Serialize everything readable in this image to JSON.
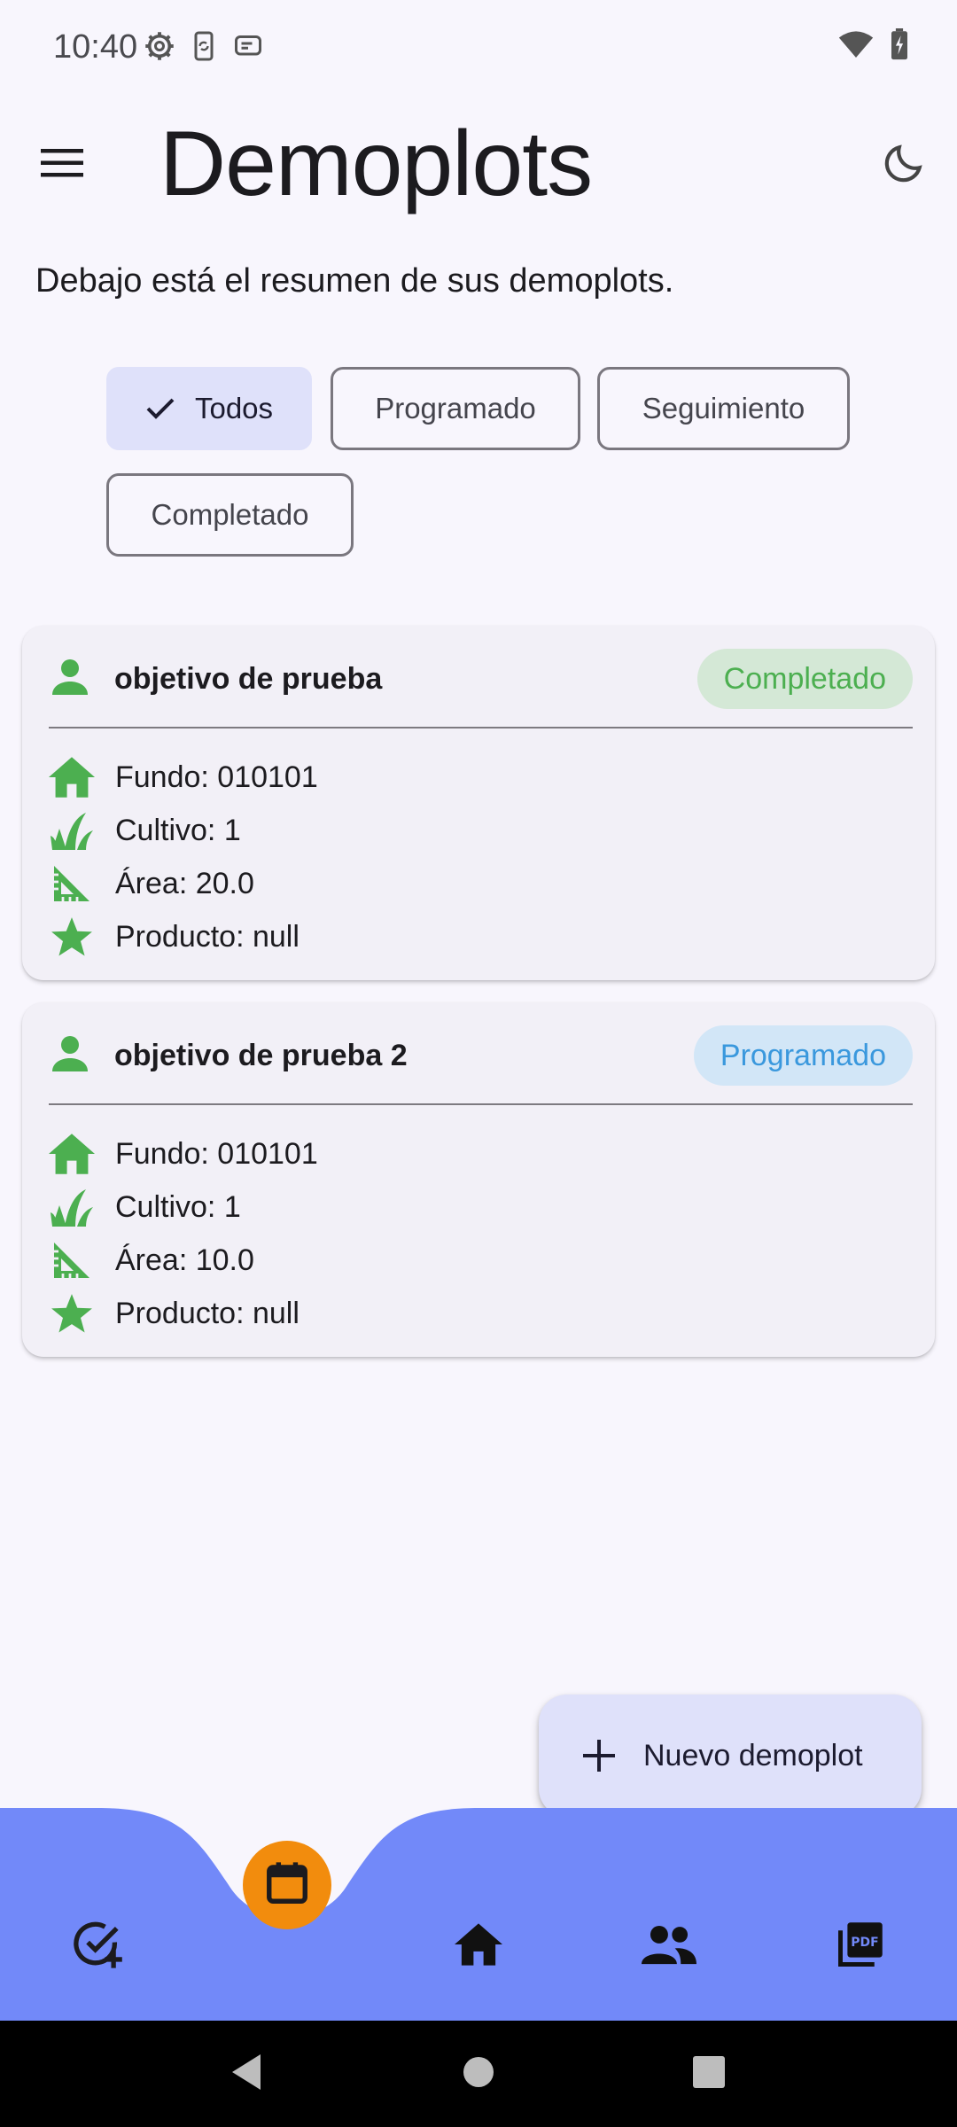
{
  "status_bar": {
    "time": "10:40",
    "left_icons": [
      "gear-icon",
      "phone-sync-icon",
      "message-icon"
    ],
    "right_icons": [
      "wifi-icon",
      "battery-charging-icon"
    ]
  },
  "app_bar": {
    "title": "Demoplots",
    "menu_icon": "hamburger-menu-icon",
    "theme_icon": "moon-icon"
  },
  "subtitle": "Debajo está el resumen de sus demoplots.",
  "filters": [
    {
      "label": "Todos",
      "selected": true
    },
    {
      "label": "Programado",
      "selected": false
    },
    {
      "label": "Seguimiento",
      "selected": false
    },
    {
      "label": "Completado",
      "selected": false
    }
  ],
  "cards": [
    {
      "title": "objetivo de prueba",
      "status": "Completado",
      "rows": [
        {
          "icon": "home-icon",
          "text": "Fundo: 010101"
        },
        {
          "icon": "grass-icon",
          "text": "Cultivo: 1"
        },
        {
          "icon": "set-square-icon",
          "text": "Área: 20.0"
        },
        {
          "icon": "star-icon",
          "text": "Producto: null"
        }
      ]
    },
    {
      "title": "objetivo de prueba 2",
      "status": "Programado",
      "rows": [
        {
          "icon": "home-icon",
          "text": "Fundo: 010101"
        },
        {
          "icon": "grass-icon",
          "text": "Cultivo: 1"
        },
        {
          "icon": "set-square-icon",
          "text": "Área: 10.0"
        },
        {
          "icon": "star-icon",
          "text": "Producto: null"
        }
      ]
    }
  ],
  "colors": {
    "accent_green": "#4caf50",
    "scheduled_blue": "#3a98dd",
    "nav_bar": "#7289f9",
    "nav_center": "#f28c0d",
    "chip_selected": "#dfe1fa",
    "background": "#f8f6fd"
  },
  "fab": {
    "label": "Nuevo demoplot",
    "icon": "plus-icon"
  },
  "bottom_nav": {
    "items": [
      "add-task-icon",
      "calendar-icon",
      "home-icon",
      "people-icon",
      "pdf-icon"
    ],
    "selected": "calendar-icon"
  },
  "system_nav": [
    "back-icon",
    "home-circle-icon",
    "recents-icon"
  ]
}
